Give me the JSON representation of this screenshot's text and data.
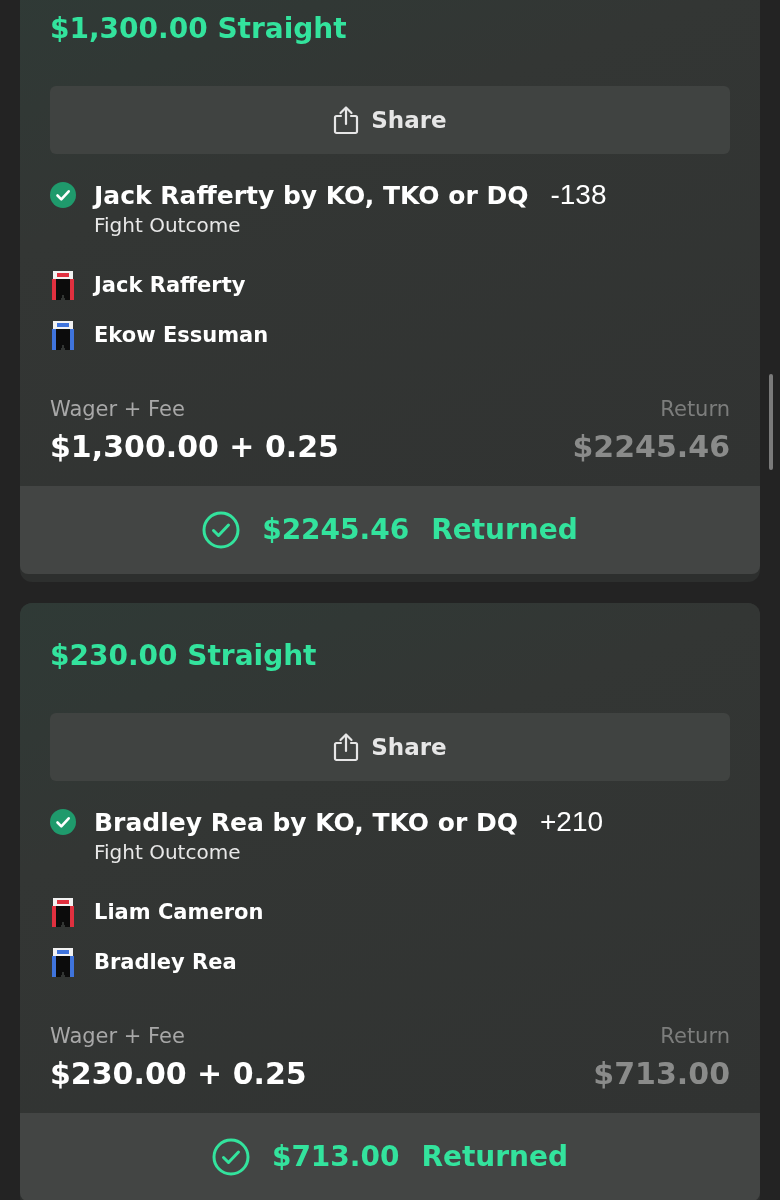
{
  "bets": [
    {
      "title": "$1,300.00 Straight",
      "share_label": "Share",
      "selection": {
        "won": true,
        "label": "Jack Rafferty by KO, TKO or DQ",
        "odds": "-138",
        "market": "Fight Outcome"
      },
      "fighters": [
        {
          "name": "Jack Rafferty",
          "color": "#e0303f"
        },
        {
          "name": "Ekow Essuman",
          "color": "#3f74dc"
        }
      ],
      "wager_label": "Wager + Fee",
      "wager": "$1,300.00 + 0.25",
      "return_label": "Return",
      "return_value": "$2245.46",
      "result": {
        "amount": "$2245.46",
        "status": "Returned"
      }
    },
    {
      "title": "$230.00 Straight",
      "share_label": "Share",
      "selection": {
        "won": true,
        "label": "Bradley Rea by KO, TKO or DQ",
        "odds": "+210",
        "market": "Fight Outcome"
      },
      "fighters": [
        {
          "name": "Liam Cameron",
          "color": "#e0303f"
        },
        {
          "name": "Bradley Rea",
          "color": "#3f74dc"
        }
      ],
      "wager_label": "Wager + Fee",
      "wager": "$230.00 + 0.25",
      "return_label": "Return",
      "return_value": "$713.00",
      "result": {
        "amount": "$713.00",
        "status": "Returned"
      }
    }
  ]
}
